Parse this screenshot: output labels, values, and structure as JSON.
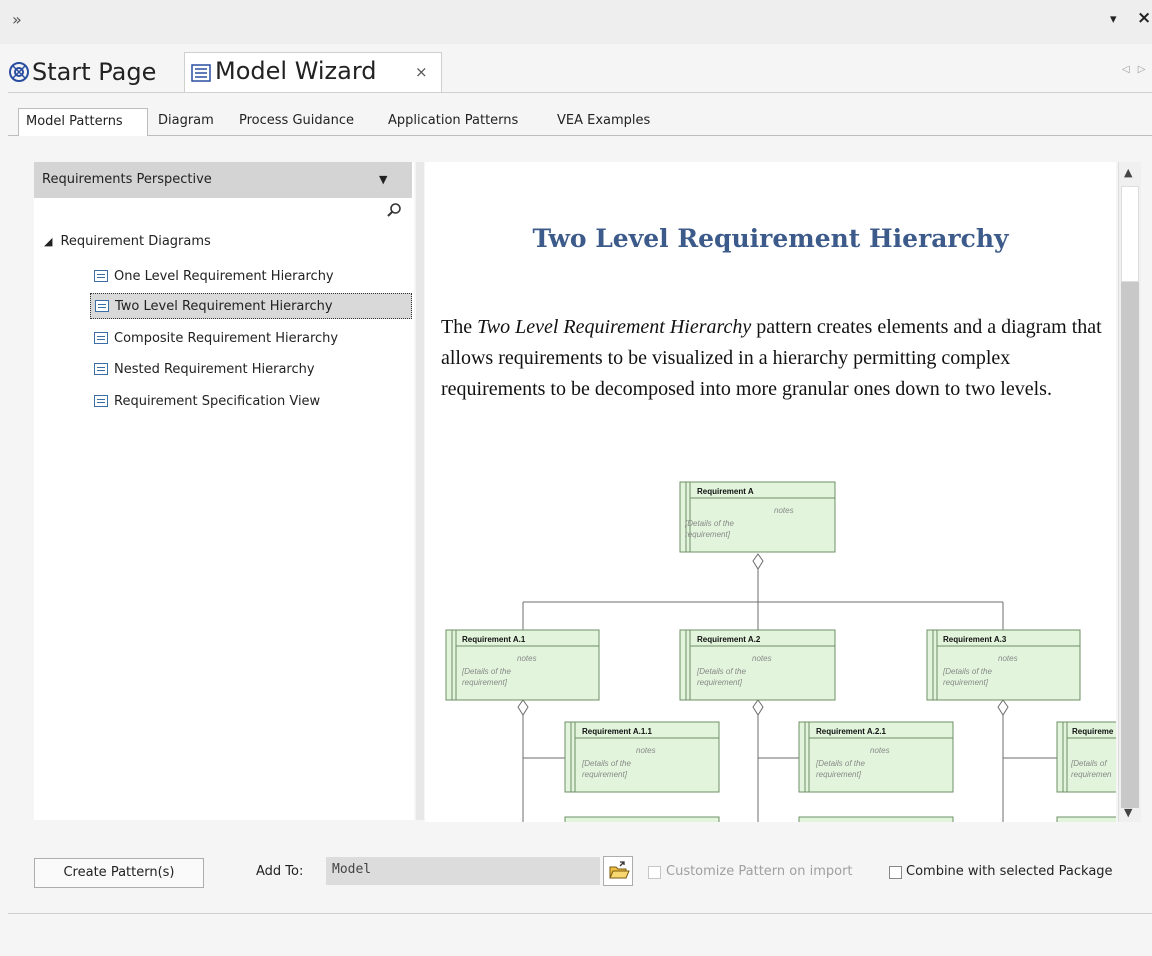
{
  "window": {
    "collapse_glyph": "»",
    "dropdown_glyph": "▾",
    "close_glyph": "×"
  },
  "doc_tabs": {
    "start_page": "Start Page",
    "model_wizard": "Model Wizard",
    "close_glyph": "×",
    "nav_left": "◁",
    "nav_right": "▷"
  },
  "inner_tabs": [
    "Model Patterns",
    "Diagram",
    "Process Guidance",
    "Application Patterns",
    "VEA Examples"
  ],
  "left_panel": {
    "perspective": "Requirements Perspective",
    "tree_root": "Requirement Diagrams",
    "items": [
      {
        "label": "One Level Requirement Hierarchy",
        "selected": false
      },
      {
        "label": "Two Level Requirement Hierarchy",
        "selected": true
      },
      {
        "label": "Composite Requirement Hierarchy",
        "selected": false
      },
      {
        "label": "Nested Requirement Hierarchy",
        "selected": false
      },
      {
        "label": "Requirement Specification View",
        "selected": false
      }
    ]
  },
  "content": {
    "title": "Two Level Requirement Hierarchy",
    "para_pre": "The ",
    "para_em": "Two Level Requirement Hierarchy",
    "para_post": " pattern creates elements and a diagram that allows requirements to be visualized in a hierarchy permitting complex requirements to be decomposed into more granular ones down to two levels.",
    "diagram": {
      "notes_label": "notes",
      "details_line1": "[Details of the",
      "details_line2": "requirement]",
      "boxes": [
        "Requirement A",
        "Requirement A.1",
        "Requirement A.2",
        "Requirement A.3",
        "Requirement A.1.1",
        "Requirement A.2.1",
        "Requireme"
      ],
      "details_partial_line1": "[Details of",
      "details_partial_line2": "requiremen"
    }
  },
  "bottom": {
    "create_button": "Create Pattern(s)",
    "add_to_label": "Add To:",
    "add_to_value": "Model",
    "customize_label": "Customize Pattern on import",
    "combine_label": "Combine with selected Package",
    "customize_checked": false,
    "customize_enabled": false,
    "combine_checked": false
  },
  "colors": {
    "title_blue": "#3c5a8a",
    "req_box_fill": "#e2f5dc",
    "req_box_border": "#6d8f66",
    "icon_blue": "#3a6ea5"
  }
}
